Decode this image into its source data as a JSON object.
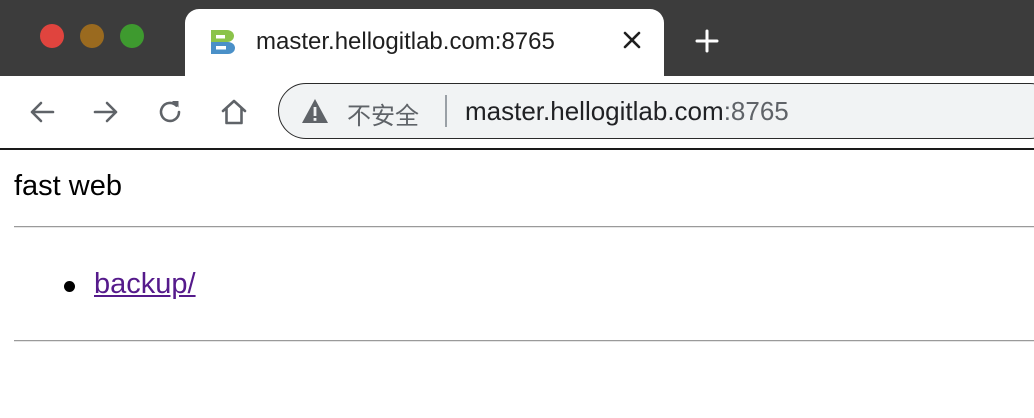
{
  "window_controls": {
    "close": "close",
    "minimize": "minimize",
    "zoom": "zoom"
  },
  "tab": {
    "title": "master.hellogitlab.com:8765",
    "favicon": "bitnami-logo-icon",
    "close_icon": "close-icon"
  },
  "new_tab_icon": "plus-icon",
  "nav": {
    "back_icon": "arrow-left-icon",
    "forward_icon": "arrow-right-icon",
    "reload_icon": "reload-icon",
    "home_icon": "home-icon"
  },
  "omnibox": {
    "security_icon": "warning-triangle-icon",
    "security_label": "不安全",
    "url_host": "master.hellogitlab.com",
    "url_port": ":8765"
  },
  "page": {
    "heading": "fast web",
    "items": [
      {
        "label": "backup/"
      }
    ]
  },
  "colors": {
    "tabbar": "#3c3c3c",
    "link_visited": "#551a8b",
    "traffic_red": "#e0443e",
    "traffic_yellow": "#9a6a1f",
    "traffic_green": "#3e9a2f"
  }
}
